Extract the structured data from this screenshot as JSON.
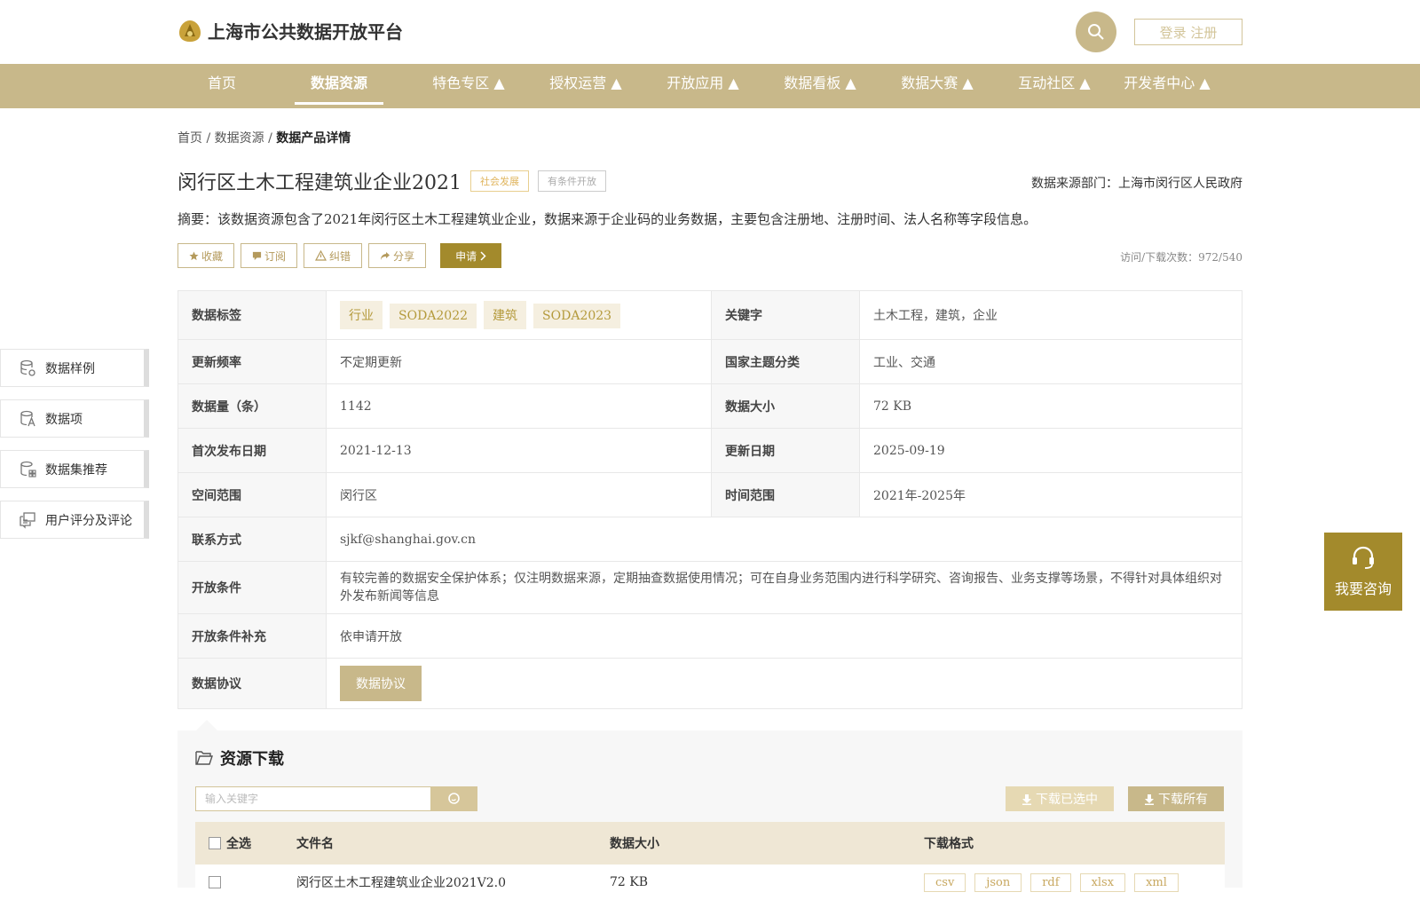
{
  "header": {
    "logo_text": "上海市公共数据开放平台",
    "login_label": "登录 注册"
  },
  "nav": {
    "items": [
      {
        "label": "首页"
      },
      {
        "label": "数据资源"
      },
      {
        "label": "特色专区 ▲"
      },
      {
        "label": "授权运营 ▲"
      },
      {
        "label": "开放应用 ▲"
      },
      {
        "label": "数据看板 ▲"
      },
      {
        "label": "数据大赛 ▲"
      },
      {
        "label": "互动社区 ▲"
      },
      {
        "label": "开发者中心 ▲"
      }
    ],
    "active_index": 1
  },
  "breadcrumb": {
    "home": "首页",
    "sep": "/",
    "resources": "数据资源",
    "current": "数据产品详情"
  },
  "product": {
    "title": "闵行区土木工程建筑业企业2021",
    "tag_category": "社会发展",
    "tag_condition": "有条件开放",
    "source_dept": "数据来源部门：上海市闵行区人民政府",
    "summary": "摘要：该数据资源包含了2021年闵行区土木工程建筑业企业，数据来源于企业码的业务数据，主要包含注册地、注册时间、法人名称等字段信息。",
    "visits": "访问/下载次数：972/540"
  },
  "actions": {
    "favorite": "收藏",
    "subscribe": "订阅",
    "report_error": "纠错",
    "share": "分享",
    "apply": "申请"
  },
  "info": {
    "tags_label": "数据标签",
    "tags": [
      "行业",
      "SODA2022",
      "建筑",
      "SODA2023"
    ],
    "keywords_label": "关键字",
    "keywords": "土木工程，建筑，企业",
    "update_freq_label": "更新频率",
    "update_freq": "不定期更新",
    "theme_label": "国家主题分类",
    "theme": "工业、交通",
    "count_label": "数据量（条）",
    "count": "1142",
    "size_label": "数据大小",
    "size": "72 KB",
    "first_pub_label": "首次发布日期",
    "first_pub": "2021-12-13",
    "updated_label": "更新日期",
    "updated": "2025-09-19",
    "spatial_label": "空间范围",
    "spatial": "闵行区",
    "time_label": "时间范围",
    "time_range": "2021年-2025年",
    "contact_label": "联系方式",
    "contact": "sjkf@shanghai.gov.cn",
    "open_cond_label": "开放条件",
    "open_cond": "有较完善的数据安全保护体系；仅注明数据来源，定期抽查数据使用情况；可在自身业务范围内进行科学研究、咨询报告、业务支撑等场景，不得针对具体组织对外发布新闻等信息",
    "open_cond_extra_label": "开放条件补充",
    "open_cond_extra": "依申请开放",
    "protocol_label": "数据协议",
    "protocol_btn": "数据协议"
  },
  "sidenav": {
    "items": [
      {
        "label": "数据样例"
      },
      {
        "label": "数据项"
      },
      {
        "label": "数据集推荐"
      },
      {
        "label": "用户评分及评论"
      }
    ]
  },
  "consult": {
    "label": "我要咨询"
  },
  "resources": {
    "title": "资源下载",
    "search_placeholder": "输入关键字",
    "download_selected": "下载已选中",
    "download_all": "下载所有",
    "columns": {
      "select_all": "全选",
      "filename": "文件名",
      "size": "数据大小",
      "format": "下载格式"
    },
    "rows": [
      {
        "filename": "闵行区土木工程建筑业企业2021V2.0",
        "size": "72 KB",
        "formats": [
          "csv",
          "json",
          "rdf",
          "xlsx",
          "xml"
        ]
      }
    ]
  },
  "colors": {
    "brand_gold": "#c8b88a",
    "apply_dark_gold": "#a38a2c"
  }
}
